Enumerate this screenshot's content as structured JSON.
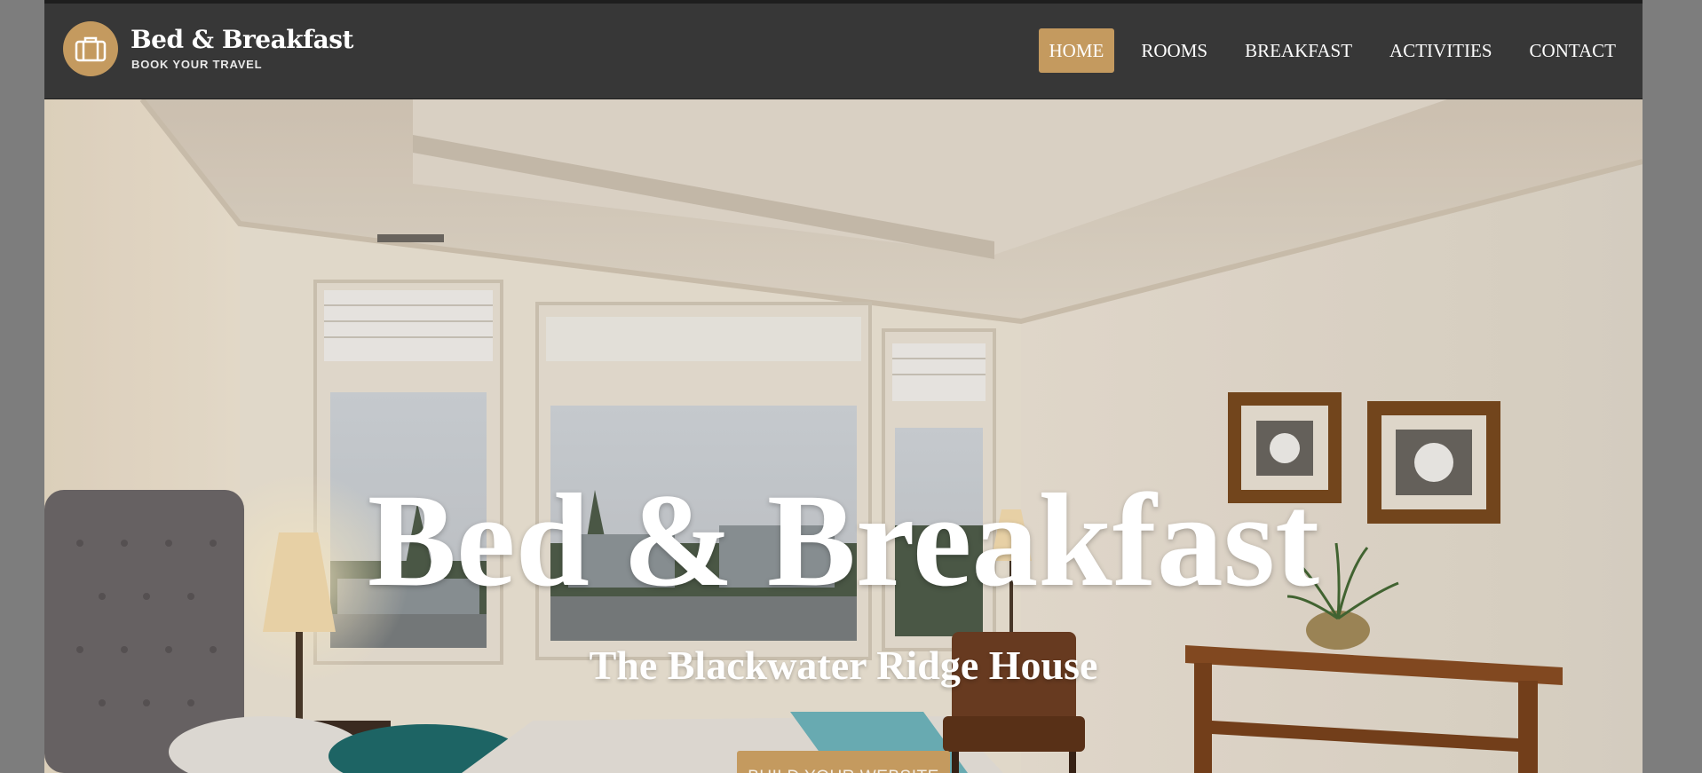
{
  "brand": {
    "title": "Bed & Breakfast",
    "tagline": "BOOK YOUR TRAVEL",
    "icon": "suitcase-icon",
    "accent_color": "#c49a5f"
  },
  "nav": {
    "items": [
      {
        "label": "HOME",
        "active": true
      },
      {
        "label": "ROOMS",
        "active": false
      },
      {
        "label": "BREAKFAST",
        "active": false
      },
      {
        "label": "ACTIVITIES",
        "active": false
      },
      {
        "label": "CONTACT",
        "active": false
      }
    ]
  },
  "hero": {
    "title": "Bed & Breakfast",
    "subtitle": "The Blackwater Ridge House",
    "cta_label": "BUILD YOUR WEBSITE"
  },
  "colors": {
    "header_bg": "#373737",
    "page_bg": "#7d7d7d"
  }
}
